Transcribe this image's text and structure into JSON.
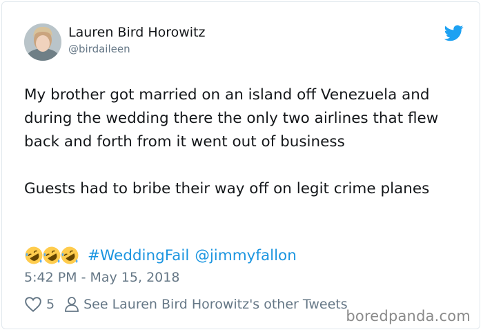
{
  "user": {
    "display_name": "Lauren Bird Horowitz",
    "handle": "@birdaileen",
    "avatar_icon": "avatar-photo"
  },
  "tweet": {
    "paragraphs": [
      "My brother got married on an island off Venezuela and during the wedding there the only two airlines that flew back and forth from it went out of business",
      "Guests had to bribe their way off on legit crime planes"
    ],
    "emojis": [
      "rolling-on-floor-laughing-emoji",
      "rolling-on-floor-laughing-emoji",
      "rolling-on-floor-laughing-emoji"
    ],
    "hashtag": "#WeddingFail",
    "mention": "@jimmyfallon",
    "timestamp": "5:42 PM - May 15, 2018"
  },
  "actions": {
    "like_count": "5",
    "see_more_label": "See Lauren Bird Horowitz's other Tweets"
  },
  "watermark": "boredpanda.com",
  "colors": {
    "link": "#1b95e0",
    "twitter_blue": "#1da1f2",
    "muted": "#657786"
  }
}
